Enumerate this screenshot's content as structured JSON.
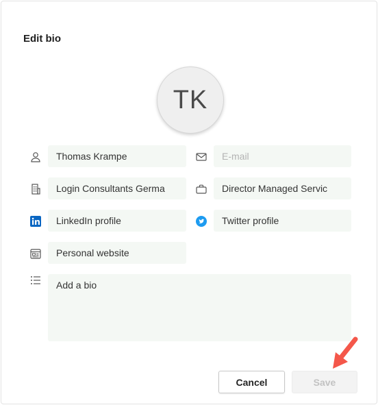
{
  "dialog": {
    "title": "Edit bio",
    "avatar_initials": "TK"
  },
  "fields": {
    "name": {
      "value": "Thomas Krampe",
      "icon": "person-icon"
    },
    "email": {
      "placeholder": "E-mail",
      "icon": "mail-icon"
    },
    "company": {
      "value": "Login Consultants Germa",
      "icon": "building-icon"
    },
    "job_title": {
      "value": "Director Managed Servic",
      "icon": "briefcase-icon"
    },
    "linkedin": {
      "value": "LinkedIn profile",
      "icon": "linkedin-icon"
    },
    "twitter": {
      "value": "Twitter profile",
      "icon": "twitter-icon"
    },
    "website": {
      "value": "Personal website",
      "icon": "website-icon"
    },
    "bio": {
      "value": "Add a bio",
      "icon": "list-icon"
    }
  },
  "buttons": {
    "cancel_label": "Cancel",
    "save_label": "Save"
  },
  "colors": {
    "field_bg": "#f4f8f4",
    "linkedin": "#0a66c2",
    "twitter": "#1d9bf0",
    "annotation_arrow": "#f4574a"
  }
}
